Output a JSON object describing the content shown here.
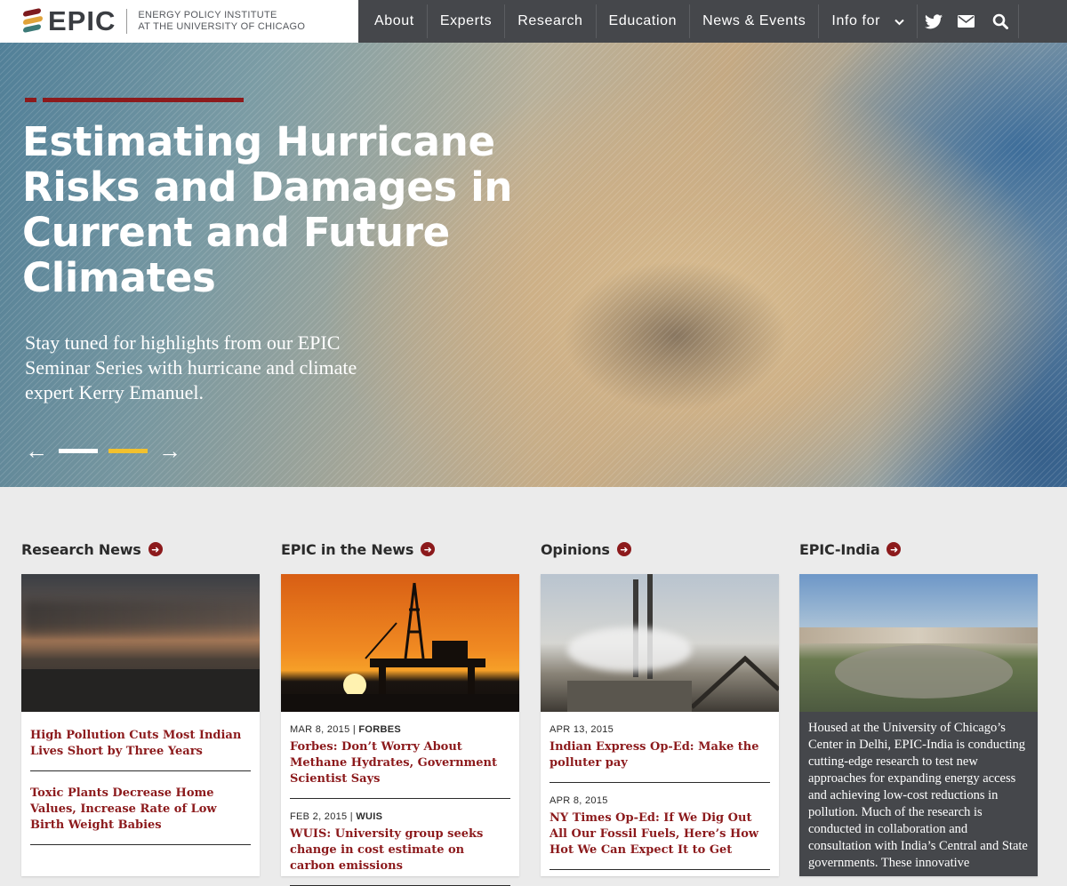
{
  "brand": {
    "name": "EPIC",
    "subtitle_line1": "ENERGY POLICY INSTITUTE",
    "subtitle_line2": "AT THE UNIVERSITY OF CHICAGO"
  },
  "nav": {
    "items": [
      {
        "label": "About"
      },
      {
        "label": "Experts"
      },
      {
        "label": "Research"
      },
      {
        "label": "Education"
      },
      {
        "label": "News & Events"
      },
      {
        "label": "Info for"
      }
    ],
    "icons": [
      "twitter-icon",
      "envelope-icon",
      "search-icon"
    ]
  },
  "hero": {
    "title": "Estimating Hurricane Risks and Damages in Current and Future Climates",
    "subtitle": "Stay tuned for highlights from our EPIC Seminar Series with hurricane and climate expert Kerry Emanuel.",
    "prev_arrow": "←",
    "next_arrow": "→",
    "slide_count": 2,
    "active_slide": 2
  },
  "sections": [
    {
      "heading": "Research News",
      "stories": [
        {
          "meta_date": "",
          "meta_source": "",
          "title": "High Pollution Cuts Most Indian Lives Short by Three Years"
        },
        {
          "meta_date": "",
          "meta_source": "",
          "title": "Toxic Plants Decrease Home Values, Increase Rate of Low Birth Weight Babies"
        }
      ]
    },
    {
      "heading": "EPIC in the News",
      "stories": [
        {
          "meta_date": "MAR 8, 2015",
          "meta_source": "FORBES",
          "title": "Forbes: Don’t Worry About Methane Hydrates, Government Scientist Says"
        },
        {
          "meta_date": "FEB 2, 2015",
          "meta_source": "WUIS",
          "title": "WUIS: University group seeks change in cost estimate on carbon emissions"
        }
      ]
    },
    {
      "heading": "Opinions",
      "stories": [
        {
          "meta_date": "APR 13, 2015",
          "meta_source": "",
          "title": "Indian Express Op-Ed: Make the polluter pay"
        },
        {
          "meta_date": "APR 8, 2015",
          "meta_source": "",
          "title": "NY Times Op-Ed: If We Dig Out All Our Fossil Fuels, Here’s How Hot We Can Expect It to Get"
        }
      ]
    },
    {
      "heading": "EPIC-India",
      "text": "Housed at the University of Chicago’s Center in Delhi, EPIC-India is conducting cutting-edge research to test new approaches for expanding energy access and achieving low-cost reductions in pollution. Much of the research is conducted in collaboration and consultation with India’s Central and State governments. These innovative"
    }
  ],
  "colors": {
    "accent": "#8c1a1c",
    "nav_bg": "#45474b",
    "slider_active": "#f2c12e",
    "page_bg": "#ebebeb"
  }
}
